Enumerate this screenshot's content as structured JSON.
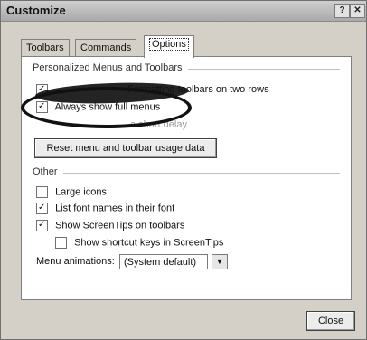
{
  "window": {
    "title": "Customize",
    "help_label": "?",
    "close_label": "✕"
  },
  "tabs": [
    {
      "label": "Toolbars"
    },
    {
      "label": "Commands"
    },
    {
      "label": "Options",
      "active": true
    }
  ],
  "personalized": {
    "group_label": "Personalized Menus and Toolbars",
    "row1_label": "Formatting toolbars on two rows",
    "row1_checked": true,
    "row2_label": "Always show full menus",
    "row2_checked": true,
    "row3_label": "a short delay",
    "reset_button_label": "Reset menu and toolbar usage data"
  },
  "other": {
    "group_label": "Other",
    "large_icons_label": "Large icons",
    "large_icons_checked": false,
    "list_font_label": "List font names in their font",
    "list_font_checked": true,
    "screentips_label": "Show ScreenTips on toolbars",
    "screentips_checked": true,
    "shortcut_keys_label": "Show shortcut keys in ScreenTips",
    "shortcut_keys_checked": false,
    "menu_animations_label": "Menu animations:",
    "menu_animations_value": "(System default)"
  },
  "footer": {
    "close_button_label": "Close"
  }
}
